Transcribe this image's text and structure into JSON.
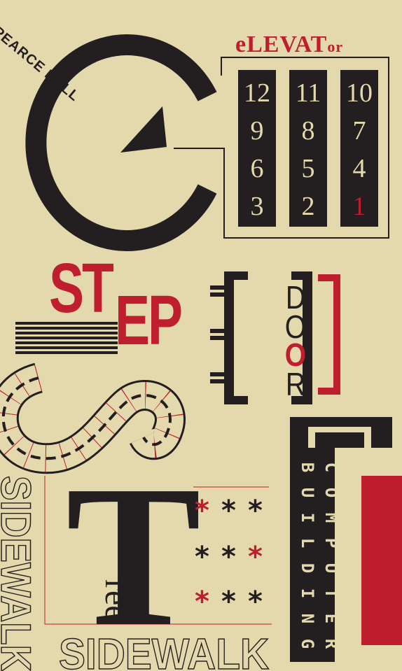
{
  "colors": {
    "background": "#e4d8ad",
    "dark": "#231f20",
    "red": "#be1e2d"
  },
  "pearce": {
    "text": "PEARCE HALL"
  },
  "elevator": {
    "title_big": "eLEVAT",
    "title_tail": "or",
    "columns": [
      [
        "12",
        "9",
        "6",
        "3"
      ],
      [
        "11",
        "8",
        "5",
        "2"
      ],
      [
        "10",
        "7",
        "4",
        "1"
      ]
    ],
    "highlighted_floor": "1"
  },
  "step": {
    "part1": "ST",
    "part2": "EP"
  },
  "door": {
    "letters": [
      "D",
      "O",
      "O",
      "R"
    ]
  },
  "computer_building": {
    "word1": [
      "C",
      "O",
      "M",
      "P",
      "U",
      "T",
      "E",
      "R"
    ],
    "word2": [
      "B",
      "U",
      "I",
      "L",
      "D",
      "I",
      "N",
      "G"
    ]
  },
  "tree": {
    "big": "T",
    "rest": "ree"
  },
  "stars": {
    "glyph": "*"
  },
  "sidewalk": {
    "horizontal": "SIDEWALK",
    "vertical": "SIDEWALK"
  }
}
